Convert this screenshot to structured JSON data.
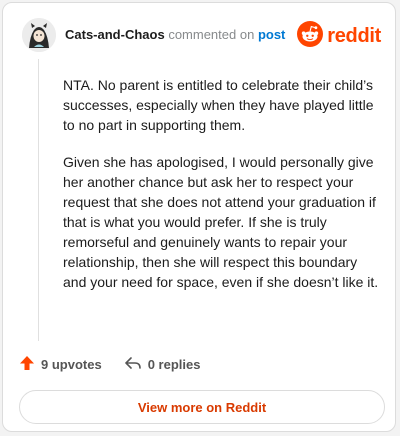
{
  "header": {
    "username": "Cats-and-Chaos",
    "commented_on": "commented on",
    "post_link": "post"
  },
  "logo": {
    "wordmark": "reddit",
    "icon": "reddit-snoo-icon",
    "brand_color": "#ff4500"
  },
  "comment": {
    "paragraphs": [
      "NTA. No parent is entitled to celebrate their child’s successes, especially when they have played little to no part in supporting them.",
      "Given she has apologised, I would personally give her another chance but ask her to respect your request that she does not attend your graduation if that is what you would prefer. If she is truly remorseful and genuinely wants to repair your relationship, then she will respect this boundary and your need for space, even if she doesn’t like it."
    ]
  },
  "actions": {
    "upvotes_label": "9 upvotes",
    "upvote_icon": "upvote-arrow-icon",
    "upvote_color": "#ff4500",
    "replies_label": "0 replies",
    "reply_icon": "reply-icon"
  },
  "footer": {
    "view_more_label": "View more on Reddit",
    "accent_color": "#d93a00"
  }
}
